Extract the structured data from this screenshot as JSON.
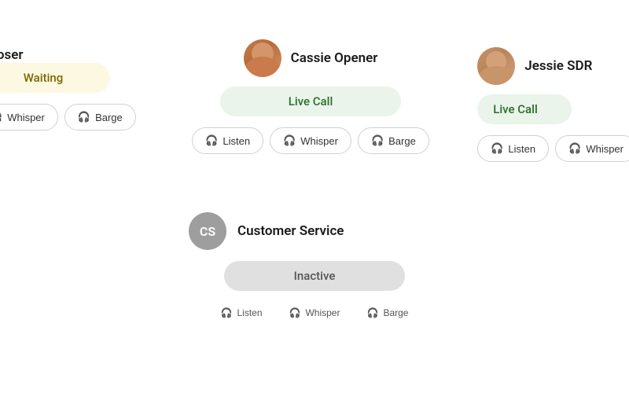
{
  "agents": [
    {
      "id": "left-partial",
      "name": "r Closer",
      "status": "Waiting",
      "statusType": "waiting",
      "buttons": [
        "Whisper",
        "Barge"
      ],
      "avatarType": "none"
    },
    {
      "id": "cassie",
      "name": "Cassie Opener",
      "status": "Live Call",
      "statusType": "live",
      "buttons": [
        "Listen",
        "Whisper",
        "Barge"
      ],
      "avatarType": "image"
    },
    {
      "id": "jessie",
      "name": "Jessie SDR",
      "status": "Live Call",
      "statusType": "live",
      "buttons": [
        "Listen",
        "Whisper"
      ],
      "avatarType": "image"
    }
  ],
  "bottomAgent": {
    "id": "customer-service",
    "initials": "CS",
    "name": "Customer Service",
    "status": "Inactive",
    "statusType": "inactive",
    "buttons": [
      "Listen",
      "Whisper",
      "Barge"
    ]
  },
  "icons": {
    "headphone": "🎧"
  },
  "labels": {
    "listen": "Listen",
    "whisper": "Whisper",
    "barge": "Barge",
    "live_call": "Live Call",
    "waiting": "Waiting",
    "inactive": "Inactive"
  }
}
